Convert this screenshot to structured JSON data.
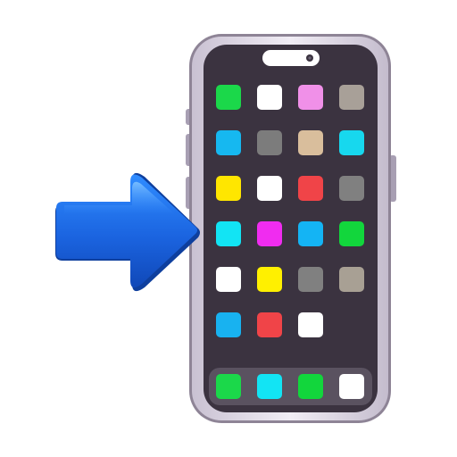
{
  "emoji": {
    "description_icon": "mobile-phone-with-arrow-icon",
    "arrow": {
      "icon": "right-arrow-icon",
      "color": "#1E6FE8"
    },
    "phone": {
      "icon": "smartphone-icon",
      "frame_color": "#D9D3E0",
      "screen_color": "#3B3340",
      "dock_color": "#5A5260"
    },
    "app_grid": [
      [
        "#1BD84A",
        "#FFFFFF",
        "#F090E8",
        "#A8A098"
      ],
      [
        "#16B8F0",
        "#7C7C7C",
        "#D9BE9C",
        "#17D8EE"
      ],
      [
        "#FFE600",
        "#FFFFFF",
        "#F04448",
        "#808080"
      ],
      [
        "#12E4F4",
        "#F02CF0",
        "#14B4F4",
        "#12D63C"
      ],
      [
        "#FFFFFF",
        "#FFF000",
        "#808080",
        "#A8A094"
      ],
      [
        "#18B2F0",
        "#F04448",
        "#FFFFFF"
      ]
    ],
    "dock_apps": [
      "#1BD84A",
      "#12E4F4",
      "#12D63C",
      "#FFFFFF"
    ]
  }
}
